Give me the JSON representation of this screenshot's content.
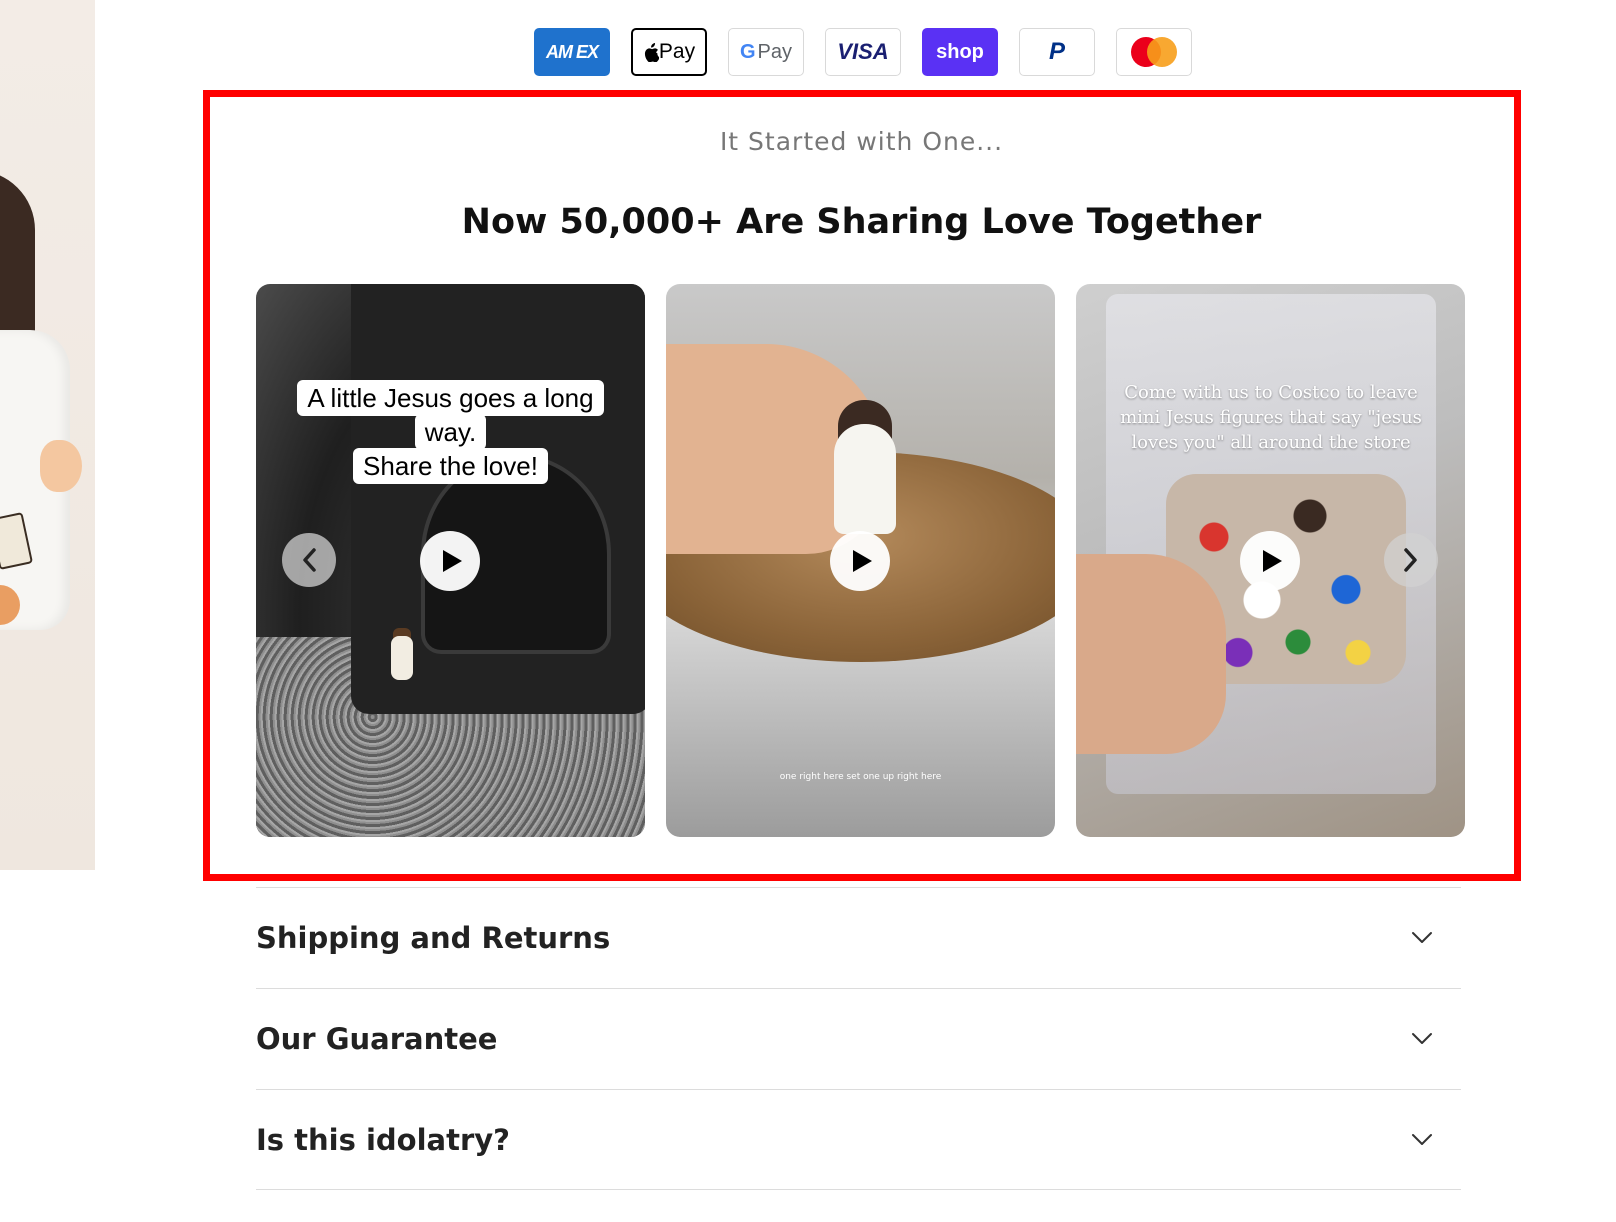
{
  "payments": {
    "amex": "AM EX",
    "apple": "Pay",
    "gpay": "Pay",
    "gpay_g": "G",
    "visa": "VISA",
    "shop": "shop",
    "paypal": "P"
  },
  "section": {
    "eyebrow": "It Started with One...",
    "title": "Now 50,000+ Are Sharing Love Together"
  },
  "videos": [
    {
      "overlay_line1": "A little Jesus goes a long",
      "overlay_line2": "way.",
      "overlay_line3": "Share the love!"
    },
    {
      "caption": "one right here set one up right here"
    },
    {
      "caption": "Come with us to Costco to leave mini Jesus figures that say \"jesus loves you\" all around the store"
    }
  ],
  "accordion": [
    {
      "label": "Shipping and Returns"
    },
    {
      "label": "Our Guarantee"
    },
    {
      "label": "Is this idolatry?"
    }
  ],
  "colors": {
    "highlight": "#ff0000",
    "amex": "#1f72cd",
    "shop": "#5a31f4",
    "visa": "#1a1f71"
  },
  "icons": [
    "play-icon",
    "chevron-left-icon",
    "chevron-right-icon",
    "chevron-down-icon"
  ]
}
